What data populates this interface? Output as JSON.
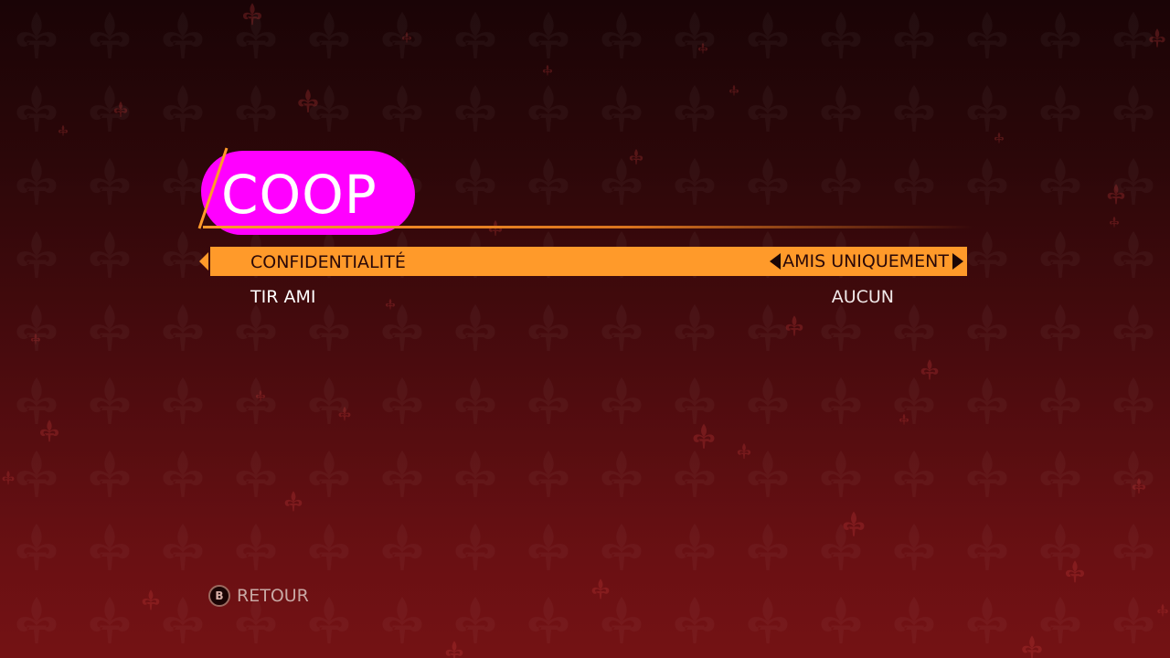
{
  "menu": {
    "title": "COOP",
    "highlight_color": "#ff00ff",
    "accent_color": "#ff9a2a"
  },
  "settings": [
    {
      "label": "CONFIDENTIALITÉ",
      "value": "AMIS UNIQUEMENT",
      "selected": true
    },
    {
      "label": "TIR AMI",
      "value": "AUCUN",
      "selected": false
    }
  ],
  "footer": {
    "button_glyph": "B",
    "back_label": "RETOUR"
  },
  "background": {
    "pattern_icon": "fleur-de-lis-icon"
  }
}
